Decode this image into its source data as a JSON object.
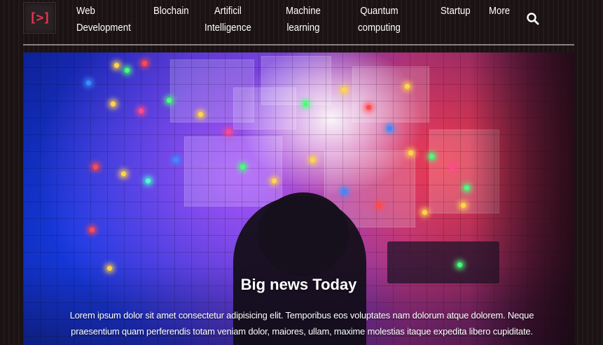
{
  "logo": {
    "text": "[>]"
  },
  "nav": {
    "items": [
      {
        "line1": "Web",
        "line2": "Development"
      },
      {
        "line1": "Blochain",
        "line2": ""
      },
      {
        "line1": "Artificil",
        "line2": "Intelligence"
      },
      {
        "line1": "Machine",
        "line2": "learning"
      },
      {
        "line1": "Quantum",
        "line2": "computing"
      },
      {
        "line1": "Startup",
        "line2": ""
      },
      {
        "line1": "More",
        "line2": ""
      }
    ],
    "search_icon": "search-icon"
  },
  "hero": {
    "title": "Big news Today",
    "text": "Lorem ipsum dolor sit amet consectetur adipisicing elit. Temporibus eos voluptates nam dolorum atque dolorem. Neque praesentium quam perferendis totam veniam dolor, maiores, ullam, maxime molestias itaque expedita libero cupiditate."
  },
  "colors": {
    "logo_accent": "#e8384f",
    "background": "#1c1416",
    "nav_text": "#ffffff"
  }
}
